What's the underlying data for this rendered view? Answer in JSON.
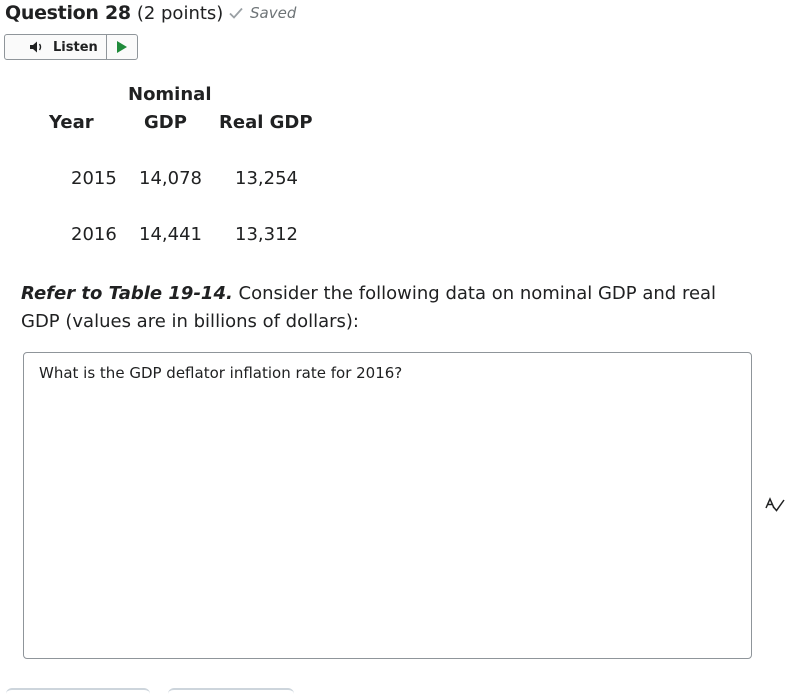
{
  "question": {
    "title": "Question 28",
    "points": "(2 points)",
    "status": "Saved"
  },
  "listen": {
    "label": "Listen"
  },
  "table": {
    "headers": {
      "year": "Year",
      "nominal_line1": "Nominal",
      "nominal_line2": "GDP",
      "real": "Real GDP"
    },
    "rows": [
      {
        "year": "2015",
        "nominal": "14,078",
        "real": "13,254"
      },
      {
        "year": "2016",
        "nominal": "14,441",
        "real": "13,312"
      }
    ]
  },
  "prompt": {
    "reference": "Refer to Table 19-14.",
    "text": " Consider the following data on nominal GDP and real GDP (values are in billions of dollars):"
  },
  "answer_box": {
    "value": "What is the GDP deflator inflation rate for 2016?"
  },
  "icons": {
    "saved": "checkmark-icon",
    "listen": "speaker-icon",
    "play": "play-icon",
    "spellcheck": "spellcheck-icon"
  },
  "colors": {
    "play": "#1f8a3a",
    "muted": "#6e7477",
    "border": "#8f959a"
  }
}
